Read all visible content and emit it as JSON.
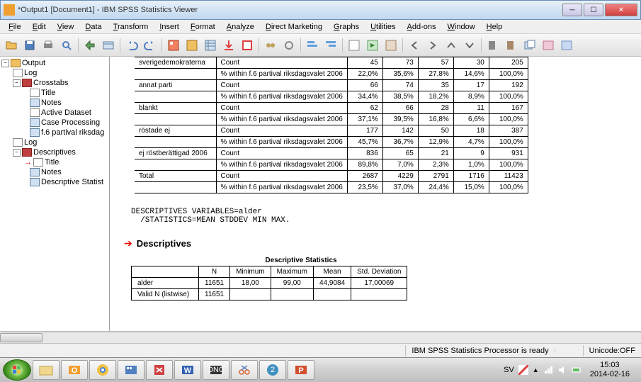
{
  "window": {
    "title": "*Output1 [Document1] - IBM SPSS Statistics Viewer"
  },
  "menus": [
    "File",
    "Edit",
    "View",
    "Data",
    "Transform",
    "Insert",
    "Format",
    "Analyze",
    "Direct Marketing",
    "Graphs",
    "Utilities",
    "Add-ons",
    "Window",
    "Help"
  ],
  "outline": {
    "root": "Output",
    "items": [
      "Log",
      "Crosstabs",
      "Title",
      "Notes",
      "Active Dataset",
      "Case Processing",
      "f.6 partival riksdag",
      "Log",
      "Descriptives",
      "Title",
      "Notes",
      "Descriptive Statist"
    ]
  },
  "crosstab": {
    "pct_label": "% within f.6 partival riksdagsvalet 2006",
    "count_label": "Count",
    "rows": [
      {
        "cat": "sverigedemokraterna",
        "count": [
          "45",
          "73",
          "57",
          "30",
          "205"
        ],
        "pct": [
          "22,0%",
          "35,6%",
          "27,8%",
          "14,6%",
          "100,0%"
        ]
      },
      {
        "cat": "annat parti",
        "count": [
          "66",
          "74",
          "35",
          "17",
          "192"
        ],
        "pct": [
          "34,4%",
          "38,5%",
          "18,2%",
          "8,9%",
          "100,0%"
        ]
      },
      {
        "cat": "blankt",
        "count": [
          "62",
          "66",
          "28",
          "11",
          "167"
        ],
        "pct": [
          "37,1%",
          "39,5%",
          "16,8%",
          "6,6%",
          "100,0%"
        ]
      },
      {
        "cat": "röstade ej",
        "count": [
          "177",
          "142",
          "50",
          "18",
          "387"
        ],
        "pct": [
          "45,7%",
          "36,7%",
          "12,9%",
          "4,7%",
          "100,0%"
        ]
      },
      {
        "cat": "ej röstberättigad 2006",
        "count": [
          "836",
          "65",
          "21",
          "9",
          "931"
        ],
        "pct": [
          "89,8%",
          "7,0%",
          "2,3%",
          "1,0%",
          "100,0%"
        ]
      }
    ],
    "total": {
      "label": "Total",
      "count": [
        "2687",
        "4229",
        "2791",
        "1716",
        "11423"
      ],
      "pct": [
        "23,5%",
        "37,0%",
        "24,4%",
        "15,0%",
        "100,0%"
      ]
    }
  },
  "syntax": "DESCRIPTIVES VARIABLES=alder\n  /STATISTICS=MEAN STDDEV MIN MAX.",
  "descriptives": {
    "heading": "Descriptives",
    "caption": "Descriptive Statistics",
    "headers": [
      "",
      "N",
      "Minimum",
      "Maximum",
      "Mean",
      "Std. Deviation"
    ],
    "rows": [
      {
        "label": "alder",
        "vals": [
          "11651",
          "18,00",
          "99,00",
          "44,9084",
          "17,00069"
        ]
      },
      {
        "label": "Valid N (listwise)",
        "vals": [
          "11651",
          "",
          "",
          "",
          ""
        ]
      }
    ]
  },
  "status": {
    "processor": "IBM SPSS Statistics Processor is ready",
    "unicode": "Unicode:OFF"
  },
  "taskbar": {
    "lang": "SV",
    "time": "15:03",
    "date": "2014-02-16"
  }
}
